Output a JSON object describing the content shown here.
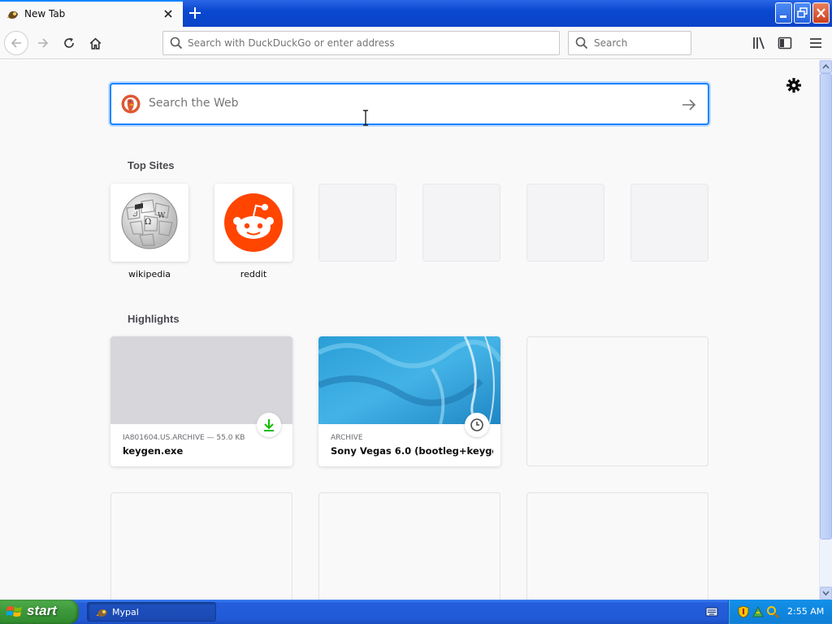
{
  "browser": {
    "tab_title": "New Tab",
    "url_placeholder": "Search with DuckDuckGo or enter address",
    "search_placeholder": "Search"
  },
  "newtab": {
    "search_placeholder": "Search the Web",
    "top_sites_title": "Top Sites",
    "top_sites": [
      {
        "label": "wikipedia"
      },
      {
        "label": "reddit"
      }
    ],
    "highlights_title": "Highlights",
    "highlights": [
      {
        "source": "IA801604.US.ARCHIVE — 55.0 KB",
        "title": "keygen.exe",
        "badge": "download-icon"
      },
      {
        "source": "ARCHIVE",
        "title": "Sony Vegas 6.0 (bootleg+keyge...",
        "badge": "clock-icon"
      }
    ]
  },
  "taskbar": {
    "start_label": "start",
    "task_label": "Mypal",
    "clock": "2:55 AM"
  },
  "colors": {
    "accent": "#0a84ff",
    "reddit": "#ff4500",
    "download_green": "#12bc00"
  }
}
